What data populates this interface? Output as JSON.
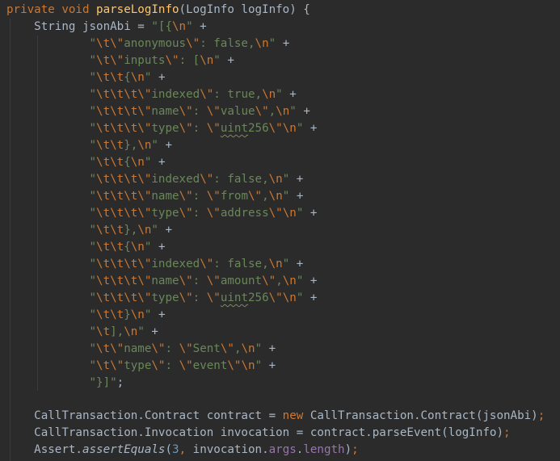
{
  "editor": {
    "language": "java",
    "theme": {
      "background": "#2b2b2b",
      "default_text": "#a9b7c6",
      "keyword": "#cc7832",
      "method_declaration": "#ffc66d",
      "string": "#6a8759",
      "escape": "#cc7832",
      "number": "#6897bb",
      "field": "#9876aa"
    },
    "lines": [
      [
        [
          "kw",
          "private void "
        ],
        [
          "fn",
          "parseLogInfo"
        ],
        [
          "t",
          "(LogInfo logInfo) {"
        ]
      ],
      [
        [
          "t",
          "    String jsonAbi = "
        ],
        [
          "str",
          "\"[{"
        ],
        [
          "esc",
          "\\n"
        ],
        [
          "str",
          "\""
        ],
        [
          "t",
          " +"
        ]
      ],
      [
        [
          "str",
          "            \""
        ],
        [
          "esc",
          "\\t\\\""
        ],
        [
          "str",
          "anonymous"
        ],
        [
          "esc",
          "\\\""
        ],
        [
          "str",
          ": false,"
        ],
        [
          "esc",
          "\\n"
        ],
        [
          "str",
          "\""
        ],
        [
          "t",
          " +"
        ]
      ],
      [
        [
          "str",
          "            \""
        ],
        [
          "esc",
          "\\t\\\""
        ],
        [
          "str",
          "inputs"
        ],
        [
          "esc",
          "\\\""
        ],
        [
          "str",
          ": ["
        ],
        [
          "esc",
          "\\n"
        ],
        [
          "str",
          "\""
        ],
        [
          "t",
          " +"
        ]
      ],
      [
        [
          "str",
          "            \""
        ],
        [
          "esc",
          "\\t\\t"
        ],
        [
          "str",
          "{"
        ],
        [
          "esc",
          "\\n"
        ],
        [
          "str",
          "\""
        ],
        [
          "t",
          " +"
        ]
      ],
      [
        [
          "str",
          "            \""
        ],
        [
          "esc",
          "\\t\\t\\t\\\""
        ],
        [
          "str",
          "indexed"
        ],
        [
          "esc",
          "\\\""
        ],
        [
          "str",
          ": true,"
        ],
        [
          "esc",
          "\\n"
        ],
        [
          "str",
          "\""
        ],
        [
          "t",
          " +"
        ]
      ],
      [
        [
          "str",
          "            \""
        ],
        [
          "esc",
          "\\t\\t\\t\\\""
        ],
        [
          "str",
          "name"
        ],
        [
          "esc",
          "\\\""
        ],
        [
          "str",
          ": "
        ],
        [
          "esc",
          "\\\""
        ],
        [
          "str",
          "value"
        ],
        [
          "esc",
          "\\\""
        ],
        [
          "str",
          ","
        ],
        [
          "esc",
          "\\n"
        ],
        [
          "str",
          "\""
        ],
        [
          "t",
          " +"
        ]
      ],
      [
        [
          "str",
          "            \""
        ],
        [
          "esc",
          "\\t\\t\\t\\\""
        ],
        [
          "str",
          "type"
        ],
        [
          "esc",
          "\\\""
        ],
        [
          "str",
          ": "
        ],
        [
          "esc",
          "\\\""
        ],
        [
          "typo",
          "uint"
        ],
        [
          "str",
          "256"
        ],
        [
          "esc",
          "\\\"\\n"
        ],
        [
          "str",
          "\""
        ],
        [
          "t",
          " +"
        ]
      ],
      [
        [
          "str",
          "            \""
        ],
        [
          "esc",
          "\\t\\t"
        ],
        [
          "str",
          "},"
        ],
        [
          "esc",
          "\\n"
        ],
        [
          "str",
          "\""
        ],
        [
          "t",
          " +"
        ]
      ],
      [
        [
          "str",
          "            \""
        ],
        [
          "esc",
          "\\t\\t"
        ],
        [
          "str",
          "{"
        ],
        [
          "esc",
          "\\n"
        ],
        [
          "str",
          "\""
        ],
        [
          "t",
          " +"
        ]
      ],
      [
        [
          "str",
          "            \""
        ],
        [
          "esc",
          "\\t\\t\\t\\\""
        ],
        [
          "str",
          "indexed"
        ],
        [
          "esc",
          "\\\""
        ],
        [
          "str",
          ": false,"
        ],
        [
          "esc",
          "\\n"
        ],
        [
          "str",
          "\""
        ],
        [
          "t",
          " +"
        ]
      ],
      [
        [
          "str",
          "            \""
        ],
        [
          "esc",
          "\\t\\t\\t\\\""
        ],
        [
          "str",
          "name"
        ],
        [
          "esc",
          "\\\""
        ],
        [
          "str",
          ": "
        ],
        [
          "esc",
          "\\\""
        ],
        [
          "str",
          "from"
        ],
        [
          "esc",
          "\\\""
        ],
        [
          "str",
          ","
        ],
        [
          "esc",
          "\\n"
        ],
        [
          "str",
          "\""
        ],
        [
          "t",
          " +"
        ]
      ],
      [
        [
          "str",
          "            \""
        ],
        [
          "esc",
          "\\t\\t\\t\\\""
        ],
        [
          "str",
          "type"
        ],
        [
          "esc",
          "\\\""
        ],
        [
          "str",
          ": "
        ],
        [
          "esc",
          "\\\""
        ],
        [
          "str",
          "address"
        ],
        [
          "esc",
          "\\\"\\n"
        ],
        [
          "str",
          "\""
        ],
        [
          "t",
          " +"
        ]
      ],
      [
        [
          "str",
          "            \""
        ],
        [
          "esc",
          "\\t\\t"
        ],
        [
          "str",
          "},"
        ],
        [
          "esc",
          "\\n"
        ],
        [
          "str",
          "\""
        ],
        [
          "t",
          " +"
        ]
      ],
      [
        [
          "str",
          "            \""
        ],
        [
          "esc",
          "\\t\\t"
        ],
        [
          "str",
          "{"
        ],
        [
          "esc",
          "\\n"
        ],
        [
          "str",
          "\""
        ],
        [
          "t",
          " +"
        ]
      ],
      [
        [
          "str",
          "            \""
        ],
        [
          "esc",
          "\\t\\t\\t\\\""
        ],
        [
          "str",
          "indexed"
        ],
        [
          "esc",
          "\\\""
        ],
        [
          "str",
          ": false,"
        ],
        [
          "esc",
          "\\n"
        ],
        [
          "str",
          "\""
        ],
        [
          "t",
          " +"
        ]
      ],
      [
        [
          "str",
          "            \""
        ],
        [
          "esc",
          "\\t\\t\\t\\\""
        ],
        [
          "str",
          "name"
        ],
        [
          "esc",
          "\\\""
        ],
        [
          "str",
          ": "
        ],
        [
          "esc",
          "\\\""
        ],
        [
          "str",
          "amount"
        ],
        [
          "esc",
          "\\\""
        ],
        [
          "str",
          ","
        ],
        [
          "esc",
          "\\n"
        ],
        [
          "str",
          "\""
        ],
        [
          "t",
          " +"
        ]
      ],
      [
        [
          "str",
          "            \""
        ],
        [
          "esc",
          "\\t\\t\\t\\\""
        ],
        [
          "str",
          "type"
        ],
        [
          "esc",
          "\\\""
        ],
        [
          "str",
          ": "
        ],
        [
          "esc",
          "\\\""
        ],
        [
          "typo",
          "uint"
        ],
        [
          "str",
          "256"
        ],
        [
          "esc",
          "\\\"\\n"
        ],
        [
          "str",
          "\""
        ],
        [
          "t",
          " +"
        ]
      ],
      [
        [
          "str",
          "            \""
        ],
        [
          "esc",
          "\\t\\t"
        ],
        [
          "str",
          "}"
        ],
        [
          "esc",
          "\\n"
        ],
        [
          "str",
          "\""
        ],
        [
          "t",
          " +"
        ]
      ],
      [
        [
          "str",
          "            \""
        ],
        [
          "esc",
          "\\t"
        ],
        [
          "str",
          "],"
        ],
        [
          "esc",
          "\\n"
        ],
        [
          "str",
          "\""
        ],
        [
          "t",
          " +"
        ]
      ],
      [
        [
          "str",
          "            \""
        ],
        [
          "esc",
          "\\t\\\""
        ],
        [
          "str",
          "name"
        ],
        [
          "esc",
          "\\\""
        ],
        [
          "str",
          ": "
        ],
        [
          "esc",
          "\\\""
        ],
        [
          "str",
          "Sent"
        ],
        [
          "esc",
          "\\\""
        ],
        [
          "str",
          ","
        ],
        [
          "esc",
          "\\n"
        ],
        [
          "str",
          "\""
        ],
        [
          "t",
          " +"
        ]
      ],
      [
        [
          "str",
          "            \""
        ],
        [
          "esc",
          "\\t\\\""
        ],
        [
          "str",
          "type"
        ],
        [
          "esc",
          "\\\""
        ],
        [
          "str",
          ": "
        ],
        [
          "esc",
          "\\\""
        ],
        [
          "str",
          "event"
        ],
        [
          "esc",
          "\\\"\\n"
        ],
        [
          "str",
          "\""
        ],
        [
          "t",
          " +"
        ]
      ],
      [
        [
          "str",
          "            \"}]\""
        ],
        [
          "t",
          ";"
        ]
      ],
      [],
      [
        [
          "t",
          "    CallTransaction.Contract contract = "
        ],
        [
          "kw",
          "new "
        ],
        [
          "t",
          "CallTransaction.Contract(jsonAbi)"
        ],
        [
          "kw",
          ";"
        ]
      ],
      [
        [
          "t",
          "    CallTransaction.Invocation invocation = contract.parseEvent(logInfo)"
        ],
        [
          "kw",
          ";"
        ]
      ],
      [
        [
          "t",
          "    Assert."
        ],
        [
          "ital",
          "assertEquals"
        ],
        [
          "t",
          "("
        ],
        [
          "num",
          "3"
        ],
        [
          "kw",
          ", "
        ],
        [
          "t",
          "invocation."
        ],
        [
          "fld",
          "args"
        ],
        [
          "t",
          "."
        ],
        [
          "fld",
          "length"
        ],
        [
          "t",
          ")"
        ],
        [
          "kw",
          ";"
        ]
      ]
    ]
  }
}
